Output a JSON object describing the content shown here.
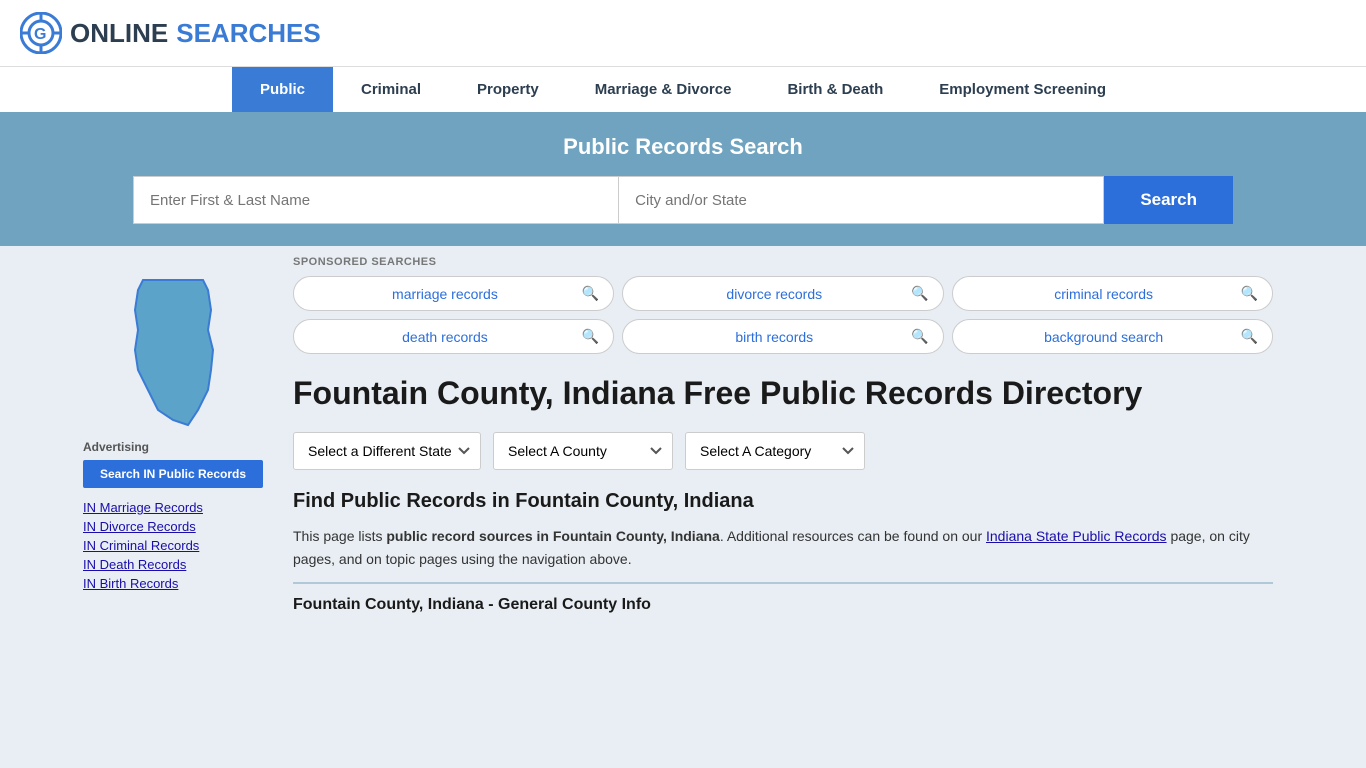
{
  "logo": {
    "text_online": "ONLINE",
    "text_searches": "SEARCHES"
  },
  "nav": {
    "items": [
      {
        "label": "Public",
        "active": true
      },
      {
        "label": "Criminal",
        "active": false
      },
      {
        "label": "Property",
        "active": false
      },
      {
        "label": "Marriage & Divorce",
        "active": false
      },
      {
        "label": "Birth & Death",
        "active": false
      },
      {
        "label": "Employment Screening",
        "active": false
      }
    ]
  },
  "search_banner": {
    "title": "Public Records Search",
    "name_placeholder": "Enter First & Last Name",
    "location_placeholder": "City and/or State",
    "button_label": "Search"
  },
  "sponsored": {
    "label": "SPONSORED SEARCHES",
    "items": [
      {
        "text": "marriage records"
      },
      {
        "text": "divorce records"
      },
      {
        "text": "criminal records"
      },
      {
        "text": "death records"
      },
      {
        "text": "birth records"
      },
      {
        "text": "background search"
      }
    ]
  },
  "page": {
    "title": "Fountain County, Indiana Free Public Records Directory",
    "dropdowns": {
      "state_label": "Select a Different State",
      "county_label": "Select A County",
      "category_label": "Select A Category"
    },
    "find_title": "Find Public Records in Fountain County, Indiana",
    "find_text_1": "This page lists ",
    "find_bold": "public record sources in Fountain County, Indiana",
    "find_text_2": ". Additional resources can be found on our ",
    "find_link": "Indiana State Public Records",
    "find_text_3": " page, on city pages, and on topic pages using the navigation above.",
    "sub_title": "Fountain County, Indiana - General County Info"
  },
  "sidebar": {
    "ad_label": "Advertising",
    "ad_button": "Search IN Public Records",
    "links": [
      {
        "text": "IN Marriage Records"
      },
      {
        "text": "IN Divorce Records"
      },
      {
        "text": "IN Criminal Records"
      },
      {
        "text": "IN Death Records"
      },
      {
        "text": "IN Birth Records"
      }
    ]
  }
}
